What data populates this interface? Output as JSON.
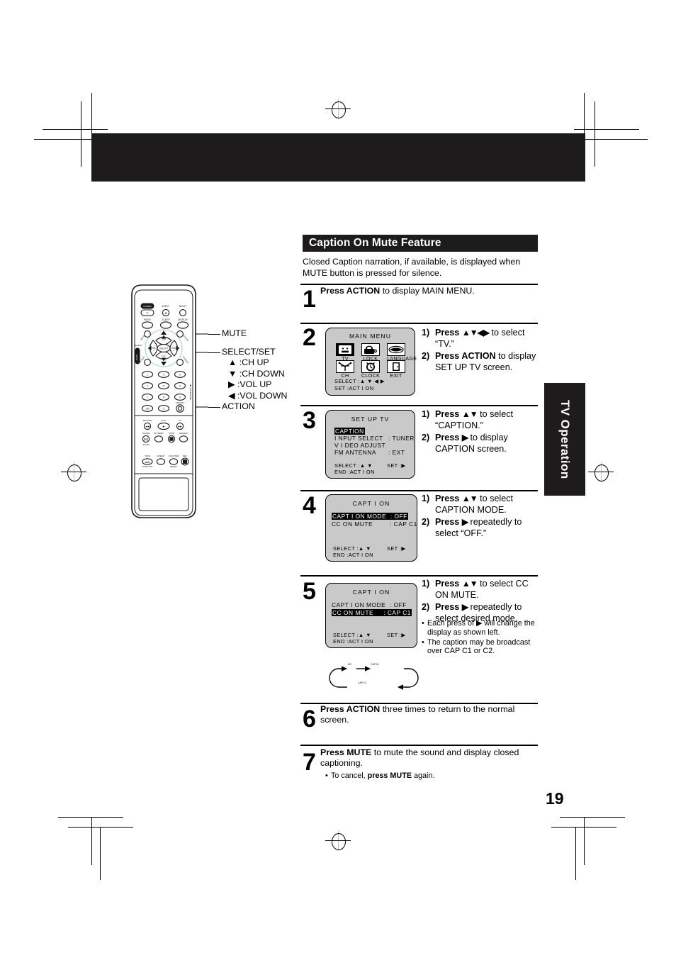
{
  "page": {
    "number": "19",
    "side_tab": "TV Operation"
  },
  "section": {
    "heading": "Caption On Mute Feature",
    "intro_line1": "Closed Caption narration, if available, is displayed when",
    "intro_line2": "MUTE button is pressed for silence."
  },
  "steps": [
    {
      "number": "1",
      "text_bold": "Press ACTION",
      "text_rest": " to display MAIN MENU."
    },
    {
      "number": "2",
      "instructions": [
        {
          "n": "1)",
          "bold": "Press",
          "arrows": "▲▼◀▶",
          "rest": " to select “TV.”"
        },
        {
          "n": "2)",
          "bold": "Press ACTION",
          "arrows": "",
          "rest": " to display SET UP TV screen."
        }
      ]
    },
    {
      "number": "3",
      "instructions": [
        {
          "n": "1)",
          "bold": "Press",
          "arrows": "▲▼",
          "rest": " to select “CAPTION.”"
        },
        {
          "n": "2)",
          "bold": "Press",
          "arrows": "▶",
          "rest": " to display CAPTION screen."
        }
      ]
    },
    {
      "number": "4",
      "instructions": [
        {
          "n": "1)",
          "bold": "Press",
          "arrows": "▲▼",
          "rest": " to select CAPTION MODE."
        },
        {
          "n": "2)",
          "bold": "Press",
          "arrows": "▶",
          "rest": " repeatedly to select  “OFF.”"
        }
      ]
    },
    {
      "number": "5",
      "instructions": [
        {
          "n": "1)",
          "bold": "Press",
          "arrows": "▲▼",
          "rest": " to select CC ON MUTE."
        },
        {
          "n": "2)",
          "bold": "Press",
          "arrows": "▶",
          "rest": " repeatedly to select desired  mode."
        }
      ],
      "notes": [
        "Each press of ▶ will change the display as shown left.",
        "The caption may be broadcast over CAP C1 or C2."
      ]
    },
    {
      "number": "6",
      "text_bold": "Press ACTION",
      "text_rest": " three times to return to the normal screen."
    },
    {
      "number": "7",
      "text_bold": "Press MUTE",
      "text_rest": " to mute the sound and display closed captioning.",
      "note_plain_1": "To cancel, ",
      "note_bold": "press MUTE",
      "note_plain_2": " again."
    }
  ],
  "osd": {
    "main_menu": {
      "title": "MAIN MENU",
      "icons": [
        {
          "label": "TV",
          "selected": true
        },
        {
          "label": "LOCK",
          "selected": false
        },
        {
          "label": "LANGUAGE",
          "selected": false
        },
        {
          "label": "CH",
          "selected": false
        },
        {
          "label": "CLOCK",
          "selected": false
        },
        {
          "label": "EXIT",
          "selected": false
        }
      ],
      "foot1": "SELECT :▲ ▼ ◀ ▶",
      "foot2": "SET     :ACT I ON"
    },
    "set_up_tv": {
      "title": "SET UP  TV",
      "rows": [
        {
          "label": "CAPTION",
          "value": "",
          "highlight": true
        },
        {
          "label": "I NPUT  SELECT",
          "value": ": TUNER",
          "highlight": false
        },
        {
          "label": "V I DEO  ADJUST",
          "value": "",
          "highlight": false
        },
        {
          "label": "FM ANTENNA",
          "value": ": EXT",
          "highlight": false
        }
      ],
      "foot1": "SELECT :▲ ▼",
      "foot1b": "SET :▶",
      "foot2": "END      :ACT I ON"
    },
    "caption_step4": {
      "title": "CAPT I ON",
      "rows": [
        {
          "label": "CAPT I ON  MODE",
          "value": ":  OFF",
          "highlight": true
        },
        {
          "label": "CC  ON  MUTE",
          "value": ":  CAP  C1",
          "highlight": false
        }
      ],
      "foot1": "SELECT :▲ ▼",
      "foot1b": "SET :▶",
      "foot2": "END      :ACT I ON"
    },
    "caption_step5": {
      "title": "CAPT I ON",
      "rows": [
        {
          "label": "CAPT I ON  MODE",
          "value": ":  OFF",
          "highlight": false
        },
        {
          "label": "CC  ON  MUTE",
          "value": ":  CAP  C1",
          "highlight": true
        }
      ],
      "foot1": "SELECT :▲ ▼",
      "foot1b": "SET :▶",
      "foot2": "END      :ACT I ON"
    }
  },
  "cycle": {
    "item1": "NO",
    "item2": "CAP C1",
    "item3": "CAP C2"
  },
  "callouts": {
    "mute": "MUTE",
    "select_set": "SELECT/SET",
    "ch_up": "▲ :CH UP",
    "ch_down": "▼ :CH DOWN",
    "vol_up": "▶ :VOL UP",
    "vol_down": "◀ :VOL DOWN",
    "action": "ACTION"
  },
  "remote": {
    "buttons": {
      "power": "POWER",
      "eject": "EJECT",
      "night": "NIGHT",
      "fmtv": "FM/TV",
      "sleep": "SLEEP",
      "display": "DISPLAY",
      "ch_up": "CH",
      "ch_down": "CH",
      "vol_down": "VOL",
      "vol_up": "VOL",
      "select": "SELECT",
      "mute": "MUTE",
      "action": "ACTION",
      "tv_vcr": "TV/VCR",
      "cancel": "CANCEL",
      "num1": "1",
      "num2": "2",
      "num3": "3",
      "num4": "4",
      "num5": "5",
      "num6": "6",
      "num7": "7",
      "num8": "8",
      "num9": "9",
      "num100": "100",
      "num0": "0",
      "add_dlt": "ADD/DLT",
      "rewind": "REWIND",
      "play": "PLAY",
      "ff": "FF",
      "pause": "PAUSE",
      "on_zero": "ON ZERO",
      "stop": "STOP",
      "search": "SEARCH",
      "slow": "SLOW",
      "tape_position": "TAPE POSITION",
      "speed": "SPEED",
      "counter_reset": "COUNTER RESET",
      "rec": "REC",
      "traverse": "TRAVERSE"
    }
  }
}
